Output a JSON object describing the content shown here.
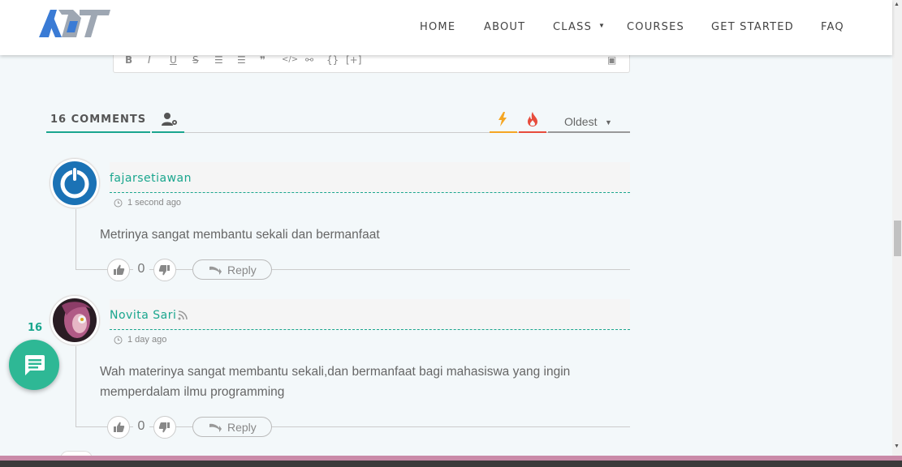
{
  "header": {
    "logo_text": "ADT",
    "nav": [
      {
        "label": "HOME"
      },
      {
        "label": "ABOUT"
      },
      {
        "label": "CLASS",
        "has_dropdown": true
      },
      {
        "label": "COURSES"
      },
      {
        "label": "GET STARTED"
      },
      {
        "label": "FAQ"
      }
    ]
  },
  "editor": {
    "tools": [
      "B",
      "I",
      "U",
      "S",
      "ordered-list",
      "unordered-list",
      "quote",
      "code",
      "link",
      "{}",
      "[+]",
      "image"
    ]
  },
  "comments_bar": {
    "count_label": "16 COMMENTS",
    "sort_label": "Oldest",
    "accent": "#1aa68e"
  },
  "comments": [
    {
      "author": "fajarsetiawan",
      "time": "1 second ago",
      "text": "Metrinya sangat membantu sekali dan bermanfaat",
      "votes": "0",
      "reply_label": "Reply"
    },
    {
      "author": "Novita Sari",
      "time": "1 day ago",
      "text": "Wah materinya sangat membantu sekali,dan bermanfaat bagi mahasiswa yang ingin memperdalam ilmu programming",
      "votes": "0",
      "reply_label": "Reply"
    }
  ],
  "floating_bubble": {
    "count": "16"
  }
}
